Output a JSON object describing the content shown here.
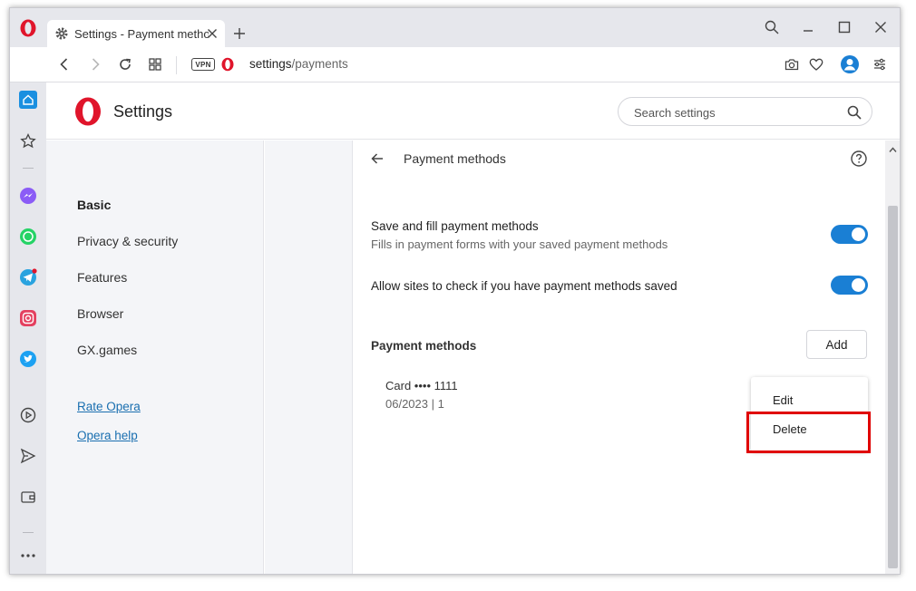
{
  "browser": {
    "tab_title": "Settings - Payment methods",
    "url_host": "settings",
    "url_path": "/payments",
    "vpn_label": "VPN",
    "brand_color": "#e0152b",
    "accent_color": "#1a7fd4"
  },
  "sidebar": {
    "items": [
      {
        "name": "home-icon"
      },
      {
        "name": "bookmarks-icon"
      },
      {
        "name": "messenger-icon"
      },
      {
        "name": "whatsapp-icon"
      },
      {
        "name": "telegram-icon"
      },
      {
        "name": "instagram-icon"
      },
      {
        "name": "twitter-icon"
      },
      {
        "name": "player-icon"
      },
      {
        "name": "send-icon"
      },
      {
        "name": "wallet-icon"
      },
      {
        "name": "more-icon"
      }
    ]
  },
  "header": {
    "title": "Settings",
    "search_placeholder": "Search settings"
  },
  "nav": {
    "items": [
      "Basic",
      "Privacy & security",
      "Features",
      "Browser",
      "GX.games"
    ],
    "links": [
      "Rate Opera",
      "Opera help"
    ]
  },
  "panel": {
    "title": "Payment methods",
    "settings": [
      {
        "title": "Save and fill payment methods",
        "subtitle": "Fills in payment forms with your saved payment methods",
        "enabled": true
      },
      {
        "title": "Allow sites to check if you have payment methods saved",
        "enabled": true
      }
    ],
    "section_title": "Payment methods",
    "add_label": "Add",
    "card": {
      "name": "Card •••• 1111",
      "meta": "06/2023 | 1"
    },
    "menu": {
      "edit": "Edit",
      "delete": "Delete"
    }
  }
}
